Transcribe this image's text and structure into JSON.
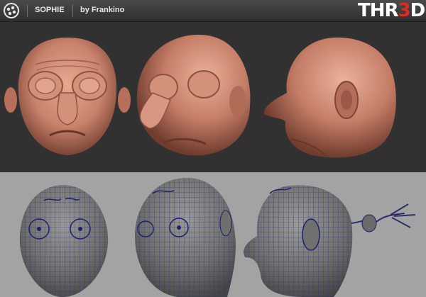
{
  "header": {
    "title": "SOPHIE",
    "byline": "by Frankino",
    "brand_left": "THR",
    "brand_mid": "3",
    "brand_right": "D",
    "brand_accent": "#e02a1e"
  },
  "renders": {
    "top_row": [
      "front-view",
      "three-quarter-view",
      "side-view"
    ],
    "bottom_row": [
      "wireframe-front",
      "wireframe-three-quarter",
      "wireframe-side"
    ],
    "skin_color": "#c9826b",
    "wire_color": "#2c2f6a"
  },
  "icons": {
    "logo": "logo-icon"
  }
}
